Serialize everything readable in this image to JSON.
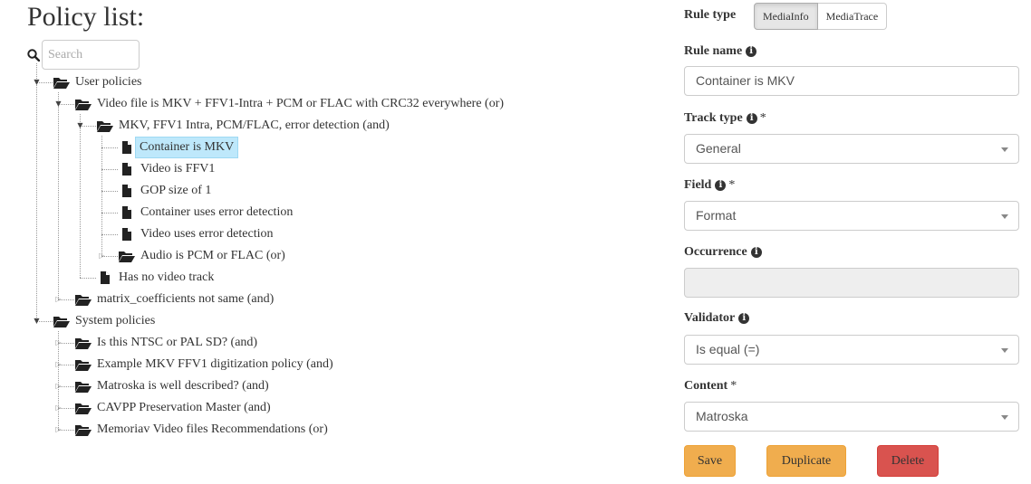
{
  "policy_list": {
    "title": "Policy list:",
    "search_placeholder": "Search",
    "nodes": [
      {
        "label": "User policies",
        "type": "folder-open"
      },
      {
        "label": "Video file is MKV + FFV1-Intra + PCM or FLAC with CRC32 everywhere (or)",
        "type": "folder-open"
      },
      {
        "label": "MKV, FFV1 Intra, PCM/FLAC, error detection (and)",
        "type": "folder-open"
      },
      {
        "label": "Container is MKV",
        "type": "file",
        "selected": true
      },
      {
        "label": "Video is FFV1",
        "type": "file"
      },
      {
        "label": "GOP size of 1",
        "type": "file"
      },
      {
        "label": "Container uses error detection",
        "type": "file"
      },
      {
        "label": "Video uses error detection",
        "type": "file"
      },
      {
        "label": "Audio is PCM or FLAC (or)",
        "type": "folder-open"
      },
      {
        "label": "Has no video track",
        "type": "file"
      },
      {
        "label": "matrix_coefficients not same (and)",
        "type": "folder-open"
      },
      {
        "label": "System policies",
        "type": "folder-open"
      },
      {
        "label": "Is this NTSC or PAL SD? (and)",
        "type": "folder-open"
      },
      {
        "label": "Example MKV FFV1 digitization policy (and)",
        "type": "folder-open"
      },
      {
        "label": "Matroska is well described? (and)",
        "type": "folder-open"
      },
      {
        "label": "CAVPP Preservation Master (and)",
        "type": "folder-open"
      },
      {
        "label": "Memoriav Video files Recommendations (or)",
        "type": "folder-open"
      }
    ]
  },
  "rule_editor": {
    "rule_type": {
      "label": "Rule type",
      "options": [
        "MediaInfo",
        "MediaTrace"
      ],
      "selected": "MediaInfo"
    },
    "rule_name": {
      "label": "Rule name",
      "value": "Container is MKV"
    },
    "track_type": {
      "label": "Track type",
      "required_mark": "*",
      "value": "General"
    },
    "field": {
      "label": "Field",
      "required_mark": "*",
      "value": "Format"
    },
    "occurrence": {
      "label": "Occurrence",
      "value": ""
    },
    "validator": {
      "label": "Validator",
      "value": "Is equal (=)"
    },
    "content": {
      "label": "Content",
      "required_mark": "*",
      "value": "Matroska"
    },
    "info_glyph": "i",
    "buttons": {
      "save": "Save",
      "duplicate": "Duplicate",
      "delete": "Delete"
    }
  },
  "colors": {
    "selected_node_bg": "#bee8fb",
    "warning": "#f0ad4e",
    "danger": "#d9534f"
  }
}
